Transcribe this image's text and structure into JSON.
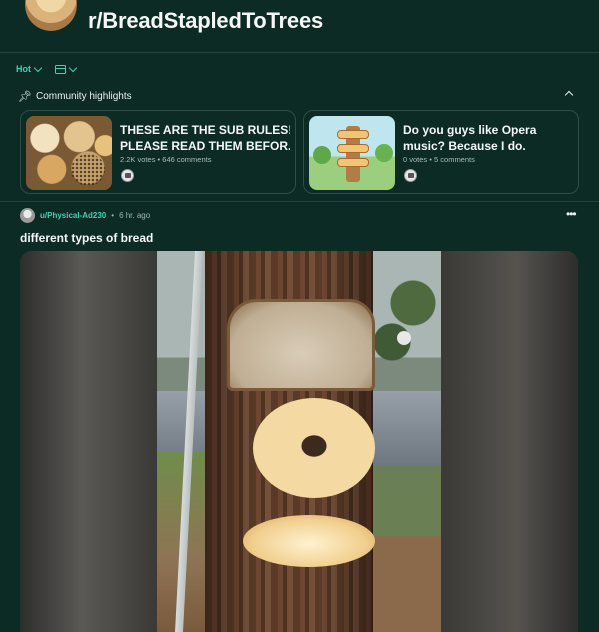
{
  "subreddit": {
    "name": "r/BreadStapledToTrees"
  },
  "controls": {
    "sort_label": "Hot",
    "layout_icon": "layout-icon"
  },
  "highlights": {
    "title": "Community highlights",
    "cards": [
      {
        "title_line1": "THESE ARE THE SUB RULES!",
        "title_line2": "PLEASE READ THEM BEFOR...",
        "votes": "2.2K votes",
        "comments": "646 comments",
        "thumb": "bread-rolls-image"
      },
      {
        "title_line1": "Do you guys like Opera",
        "title_line2": "music? Because I do.",
        "votes": "0 votes",
        "comments": "5 comments",
        "thumb": "bread-tree-illustration"
      }
    ]
  },
  "post": {
    "username": "u/Physical-Ad230",
    "separator": "•",
    "time": "6 hr. ago",
    "title": "different types of bread",
    "more_icon": "more-options-icon"
  },
  "colors": {
    "background": "#0c2b25",
    "accent": "#48d0b2",
    "border": "#2c5048"
  }
}
